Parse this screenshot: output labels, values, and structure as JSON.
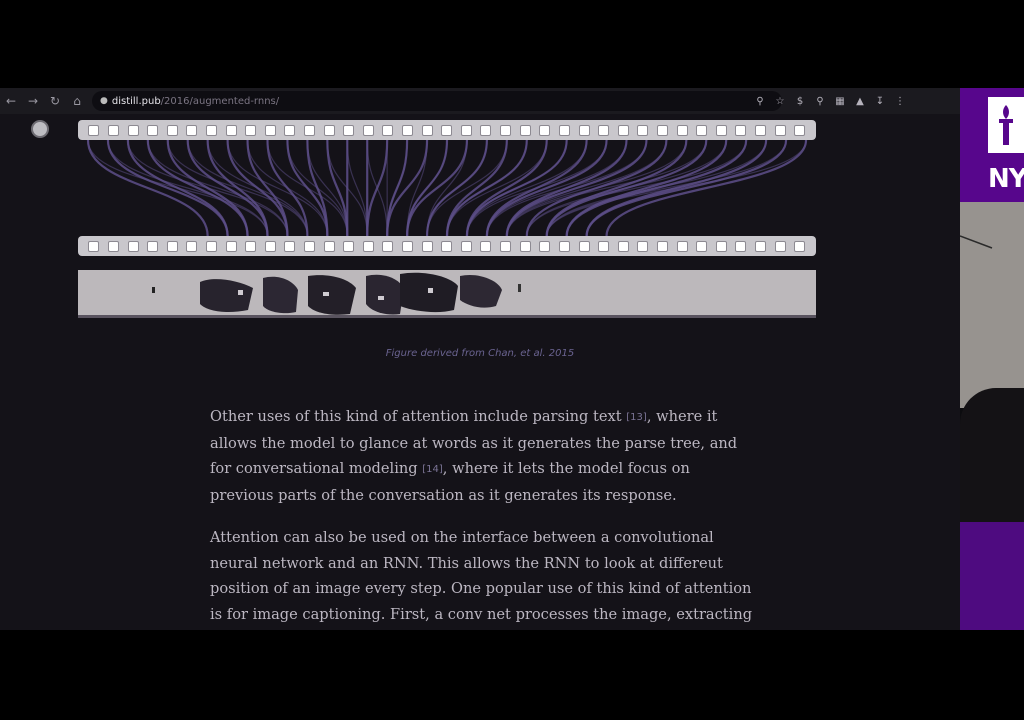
{
  "browser": {
    "url_host": "distill.pub",
    "url_path": "/2016/augmented-rnns/"
  },
  "figure": {
    "caption": "Figure derived from Chan, et al. 2015"
  },
  "article": {
    "p1_a": "Other uses of this kind of attention include parsing text ",
    "p1_cite1": "[13]",
    "p1_b": ", where it allows the model to glance at words as it generates the parse tree, and for conversational modeling ",
    "p1_cite2": "[14]",
    "p1_c": ", where it lets the model focus on previous parts of the conversation as it generates its response.",
    "p2": "Attention can also be used on the interface between a convolutional neural network and an RNN. This allows the RNN to look at differeut position of an image every step. One popular use of this kind of attention is for image captioning. First, a conv net processes the image, extracting"
  },
  "video_panel": {
    "logo_text": "NY"
  },
  "colors": {
    "page_bg": "#141218",
    "accent_purple": "#57068c",
    "attention_lines": "#5d4f8a"
  }
}
